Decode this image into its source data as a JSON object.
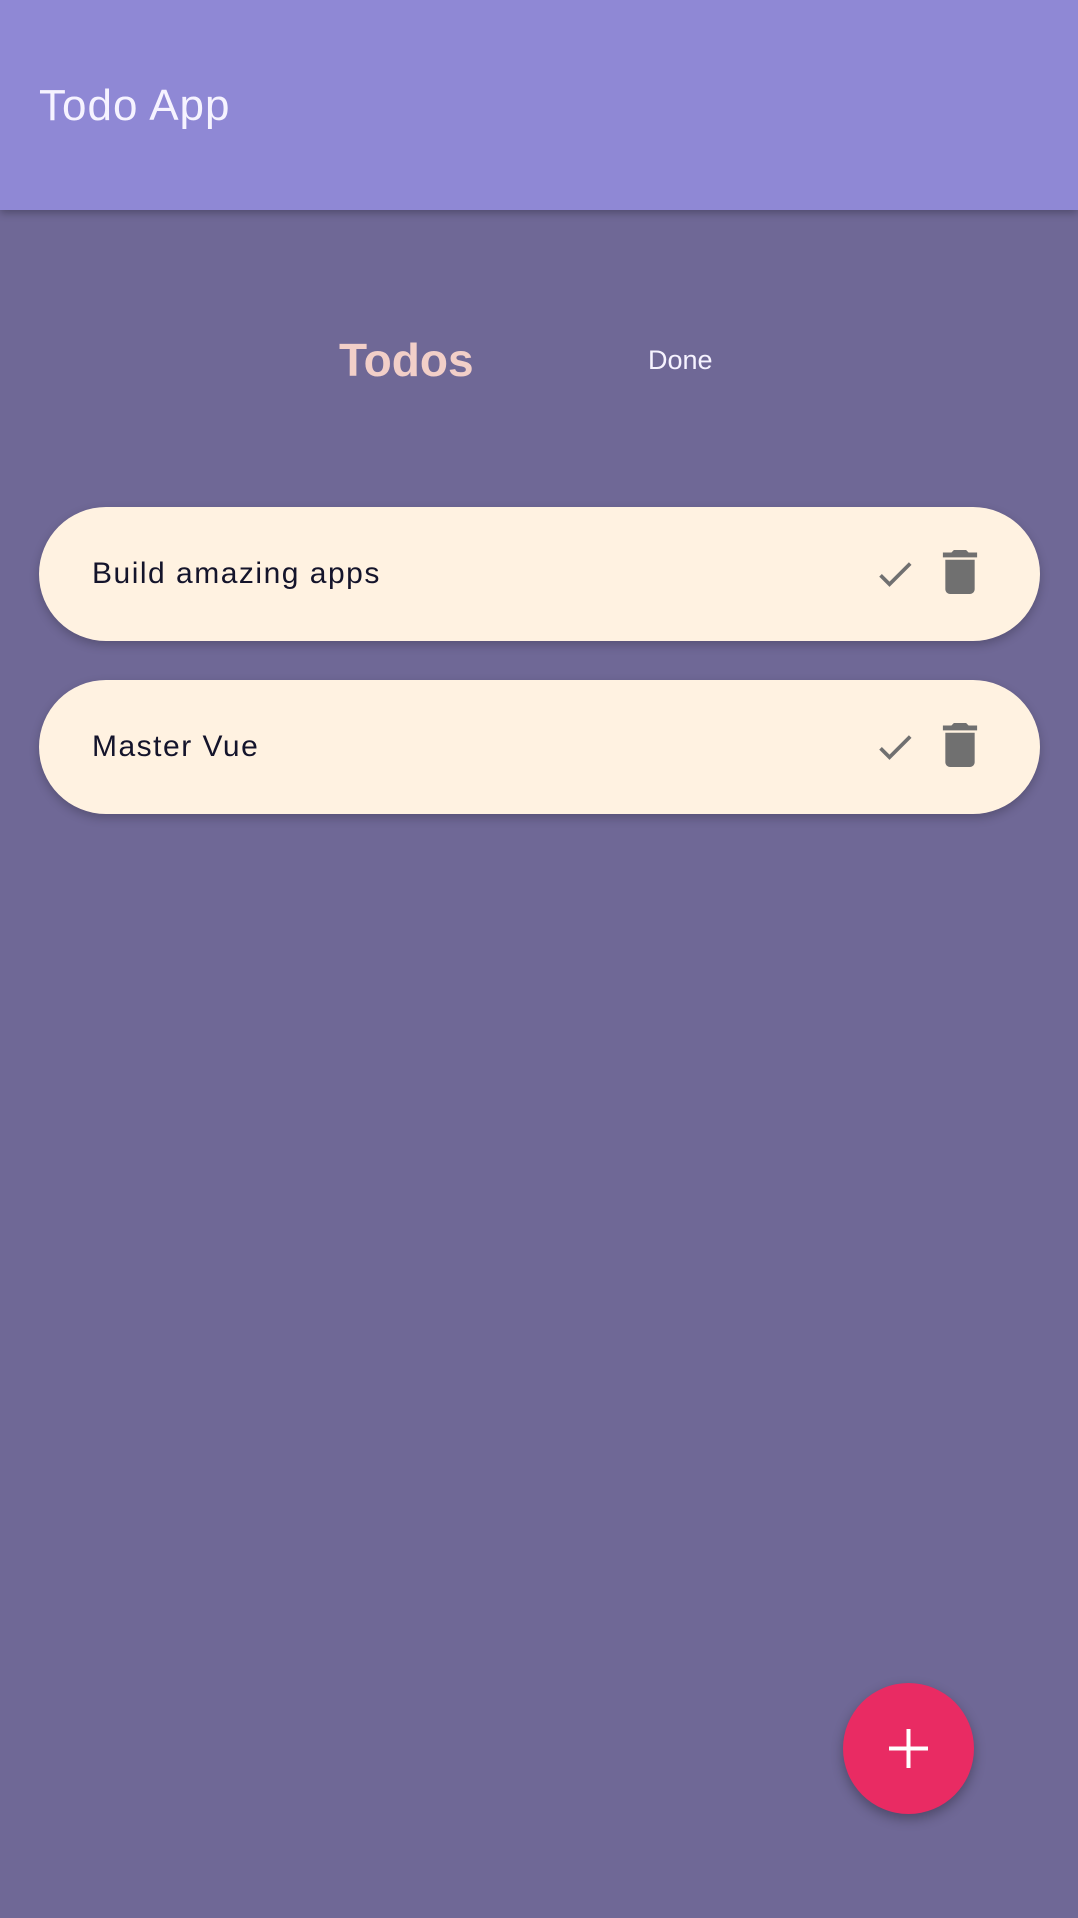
{
  "app_bar": {
    "title": "Todo App",
    "color": "#8f88d5"
  },
  "tabs": [
    {
      "label": "Todos",
      "active": true
    },
    {
      "label": "Done",
      "active": false
    }
  ],
  "todos": [
    {
      "text": "Build amazing apps",
      "actions": [
        "check-icon",
        "trash-icon"
      ]
    },
    {
      "text": "Master Vue",
      "actions": [
        "check-icon",
        "trash-icon"
      ]
    }
  ],
  "fab": {
    "icon": "plus-icon",
    "color": "#e92b63"
  },
  "colors": {
    "background": "#6f6896",
    "card": "#fff2e1",
    "active_tab": "#f2cfc8",
    "icon_gray": "#707070"
  }
}
